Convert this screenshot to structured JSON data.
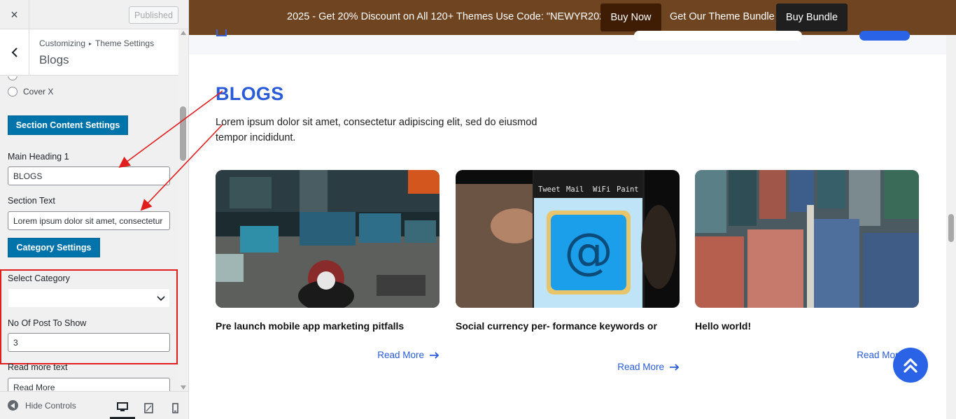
{
  "customizer": {
    "close_label": "×",
    "publish_label": "Published",
    "breadcrumb": [
      "Customizing",
      "Theme Settings"
    ],
    "breadcrumb_sep": "▸",
    "section_title": "Blogs",
    "radio_option": "Cover X",
    "section_content_button": "Section Content Settings",
    "main_heading_label": "Main Heading 1",
    "main_heading_value": "BLOGS",
    "section_text_label": "Section Text",
    "section_text_value": "Lorem ipsum dolor sit amet, consectetur",
    "category_button": "Category Settings",
    "select_category_label": "Select Category",
    "select_category_value": "",
    "post_count_label": "No Of Post To Show",
    "post_count_value": "3",
    "read_more_label": "Read more text",
    "read_more_value": "Read More",
    "hide_controls_label": "Hide Controls",
    "devices": [
      "desktop-icon",
      "tablet-icon",
      "mobile-icon"
    ]
  },
  "promo": {
    "text": "2025 - Get 20% Discount on All 120+ Themes Use Code: \"NEWYR2025\"",
    "buy_now": "Buy Now",
    "bundle_text": "Get Our Theme Bundle",
    "buy_bundle": "Buy Bundle",
    "bg_color": "#6e4421"
  },
  "blog": {
    "heading": "BLOGS",
    "text": "Lorem ipsum dolor sit amet, consectetur adipiscing elit, sed do eiusmod tempor incididunt.",
    "accent": "#2a5bd7",
    "posts": [
      {
        "title": "Pre launch mobile app marketing pitfalls",
        "read_more": "Read More",
        "image": "hacker-workspace-photo"
      },
      {
        "title": "Social currency per- formance keywords or",
        "read_more": "Read More",
        "image": "phone-email-app-photo"
      },
      {
        "title": "Hello world!",
        "read_more": "Read More",
        "image": "shipping-containers-photo"
      }
    ],
    "phone_apps": [
      "Tweet",
      "Mail",
      "WiFi",
      "Paint"
    ],
    "phone_big_icon": "@",
    "arrow_glyph": "→"
  }
}
